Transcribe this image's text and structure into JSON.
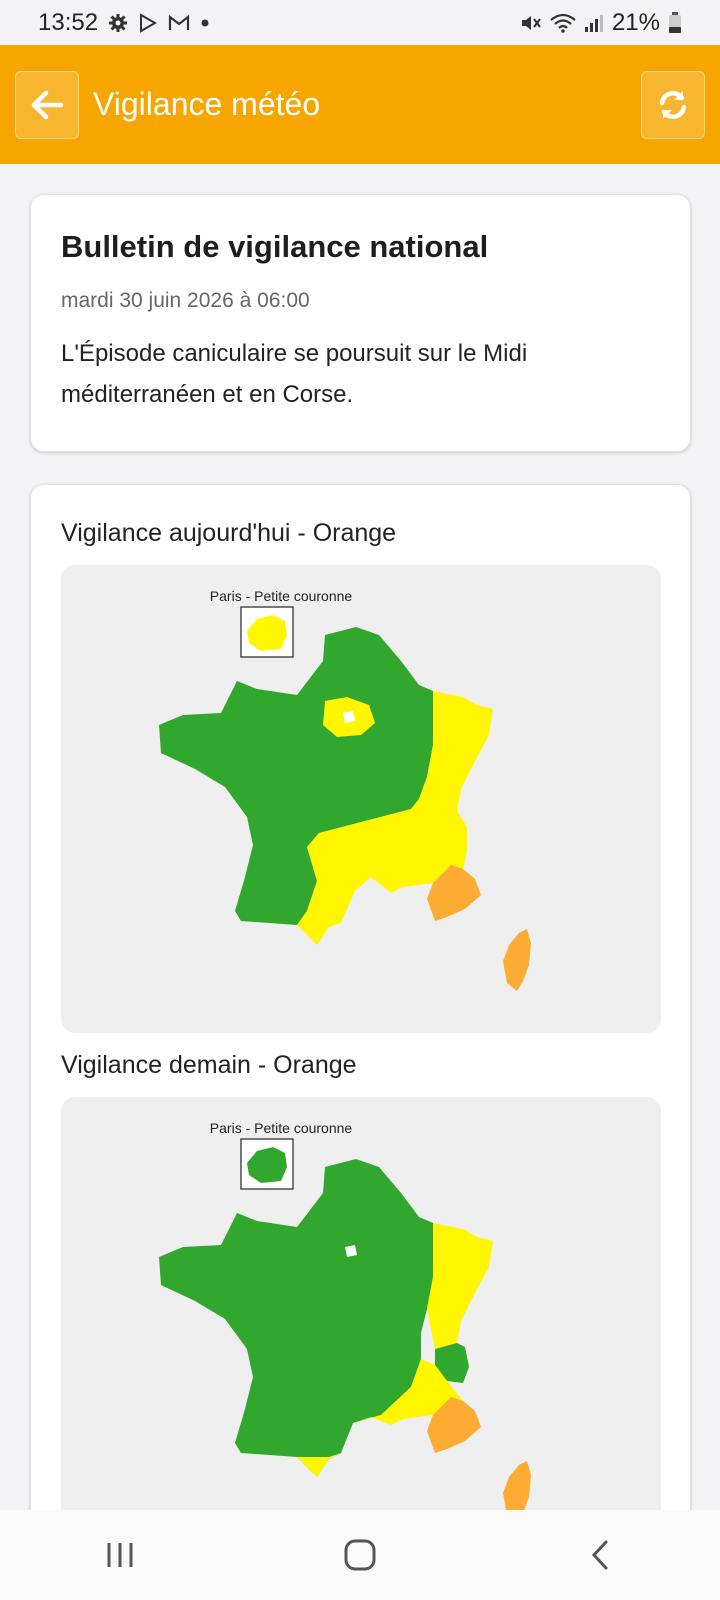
{
  "status": {
    "time": "13:52",
    "battery": "21%"
  },
  "appbar": {
    "title": "Vigilance météo"
  },
  "bulletin": {
    "title": "Bulletin de vigilance national",
    "date": "mardi 30 juin 2026 à 06:00",
    "text": "L'Épisode caniculaire se poursuit sur le Midi méditerranéen et en Corse."
  },
  "maps": [
    {
      "label": "Vigilance aujourd'hui - Orange",
      "inset_label": "Paris - Petite couronne",
      "inset_level": "yellow"
    },
    {
      "label": "Vigilance demain - Orange",
      "inset_label": "Paris - Petite couronne",
      "inset_level": "green"
    }
  ],
  "colors": {
    "accent": "#f7a600",
    "green": "#31a72e",
    "yellow": "#fff600",
    "orange": "#fcac33"
  }
}
